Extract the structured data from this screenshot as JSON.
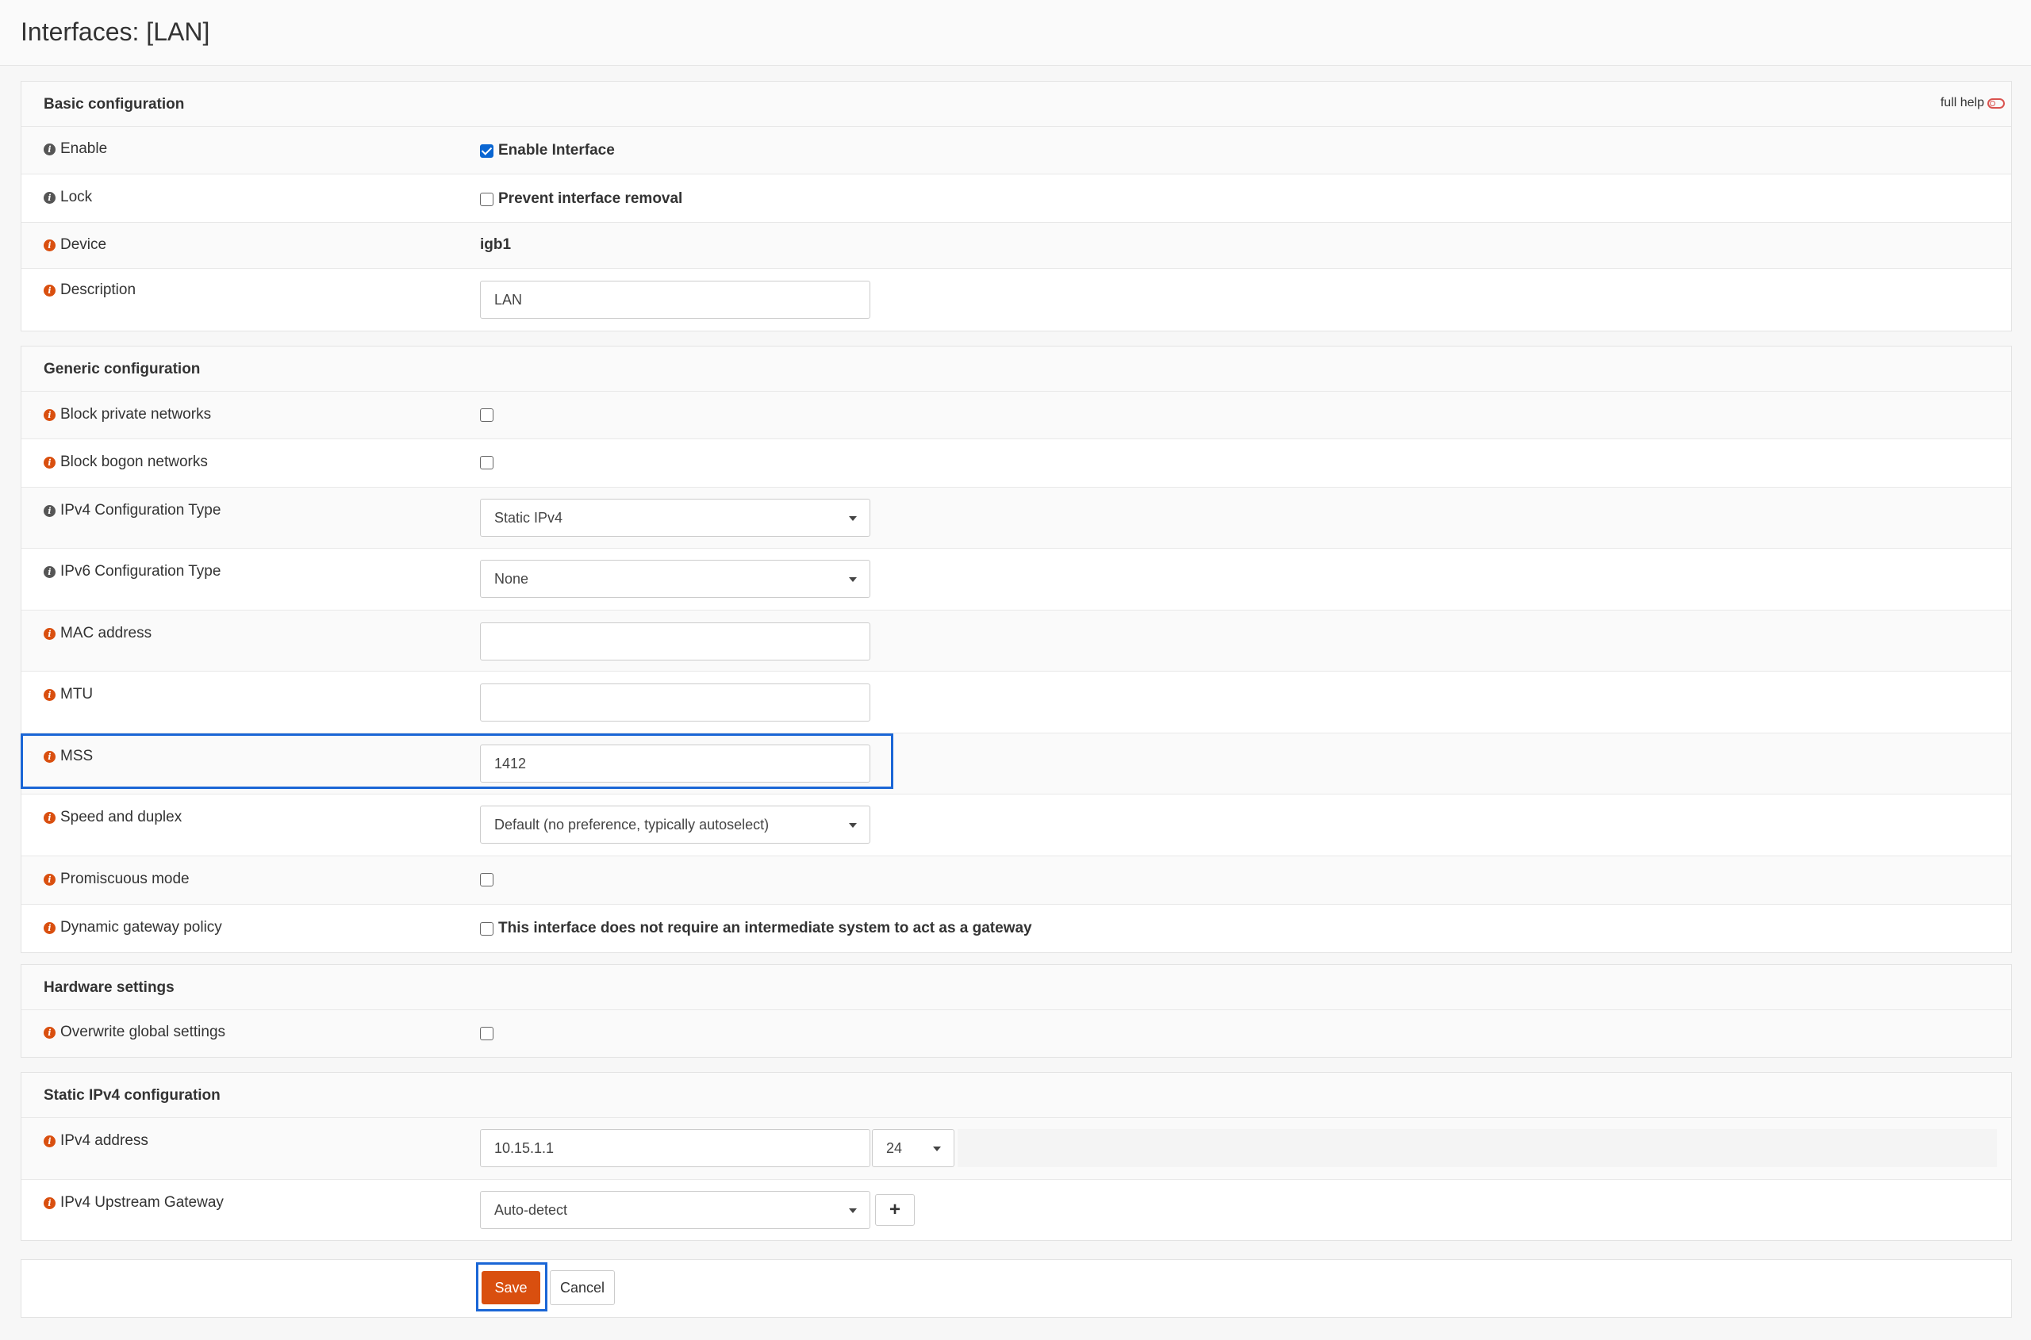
{
  "page_title": "Interfaces: [LAN]",
  "full_help_label": "full help",
  "basic": {
    "title": "Basic configuration",
    "enable_label": "Enable",
    "enable_cb_label": "Enable Interface",
    "enable_checked": true,
    "lock_label": "Lock",
    "lock_cb_label": "Prevent interface removal",
    "device_label": "Device",
    "device_value": "igb1",
    "description_label": "Description",
    "description_value": "LAN"
  },
  "generic": {
    "title": "Generic configuration",
    "block_private_label": "Block private networks",
    "block_bogon_label": "Block bogon networks",
    "ipv4_type_label": "IPv4 Configuration Type",
    "ipv4_type_value": "Static IPv4",
    "ipv6_type_label": "IPv6 Configuration Type",
    "ipv6_type_value": "None",
    "mac_label": "MAC address",
    "mac_value": "",
    "mtu_label": "MTU",
    "mtu_value": "",
    "mss_label": "MSS",
    "mss_value": "1412",
    "speed_label": "Speed and duplex",
    "speed_value": "Default (no preference, typically autoselect)",
    "promisc_label": "Promiscuous mode",
    "dyngw_label": "Dynamic gateway policy",
    "dyngw_cb_label": "This interface does not require an intermediate system to act as a gateway"
  },
  "hardware": {
    "title": "Hardware settings",
    "overwrite_label": "Overwrite global settings"
  },
  "static4": {
    "title": "Static IPv4 configuration",
    "addr_label": "IPv4 address",
    "addr_value": "10.15.1.1",
    "prefix_value": "24",
    "gw_label": "IPv4 Upstream Gateway",
    "gw_value": "Auto-detect",
    "plus_glyph": "+"
  },
  "actions": {
    "save_label": "Save",
    "cancel_label": "Cancel"
  },
  "colors": {
    "accent_orange": "#d94f0f",
    "highlight_blue": "#1a66d6",
    "checkbox_blue": "#0a66d2"
  }
}
